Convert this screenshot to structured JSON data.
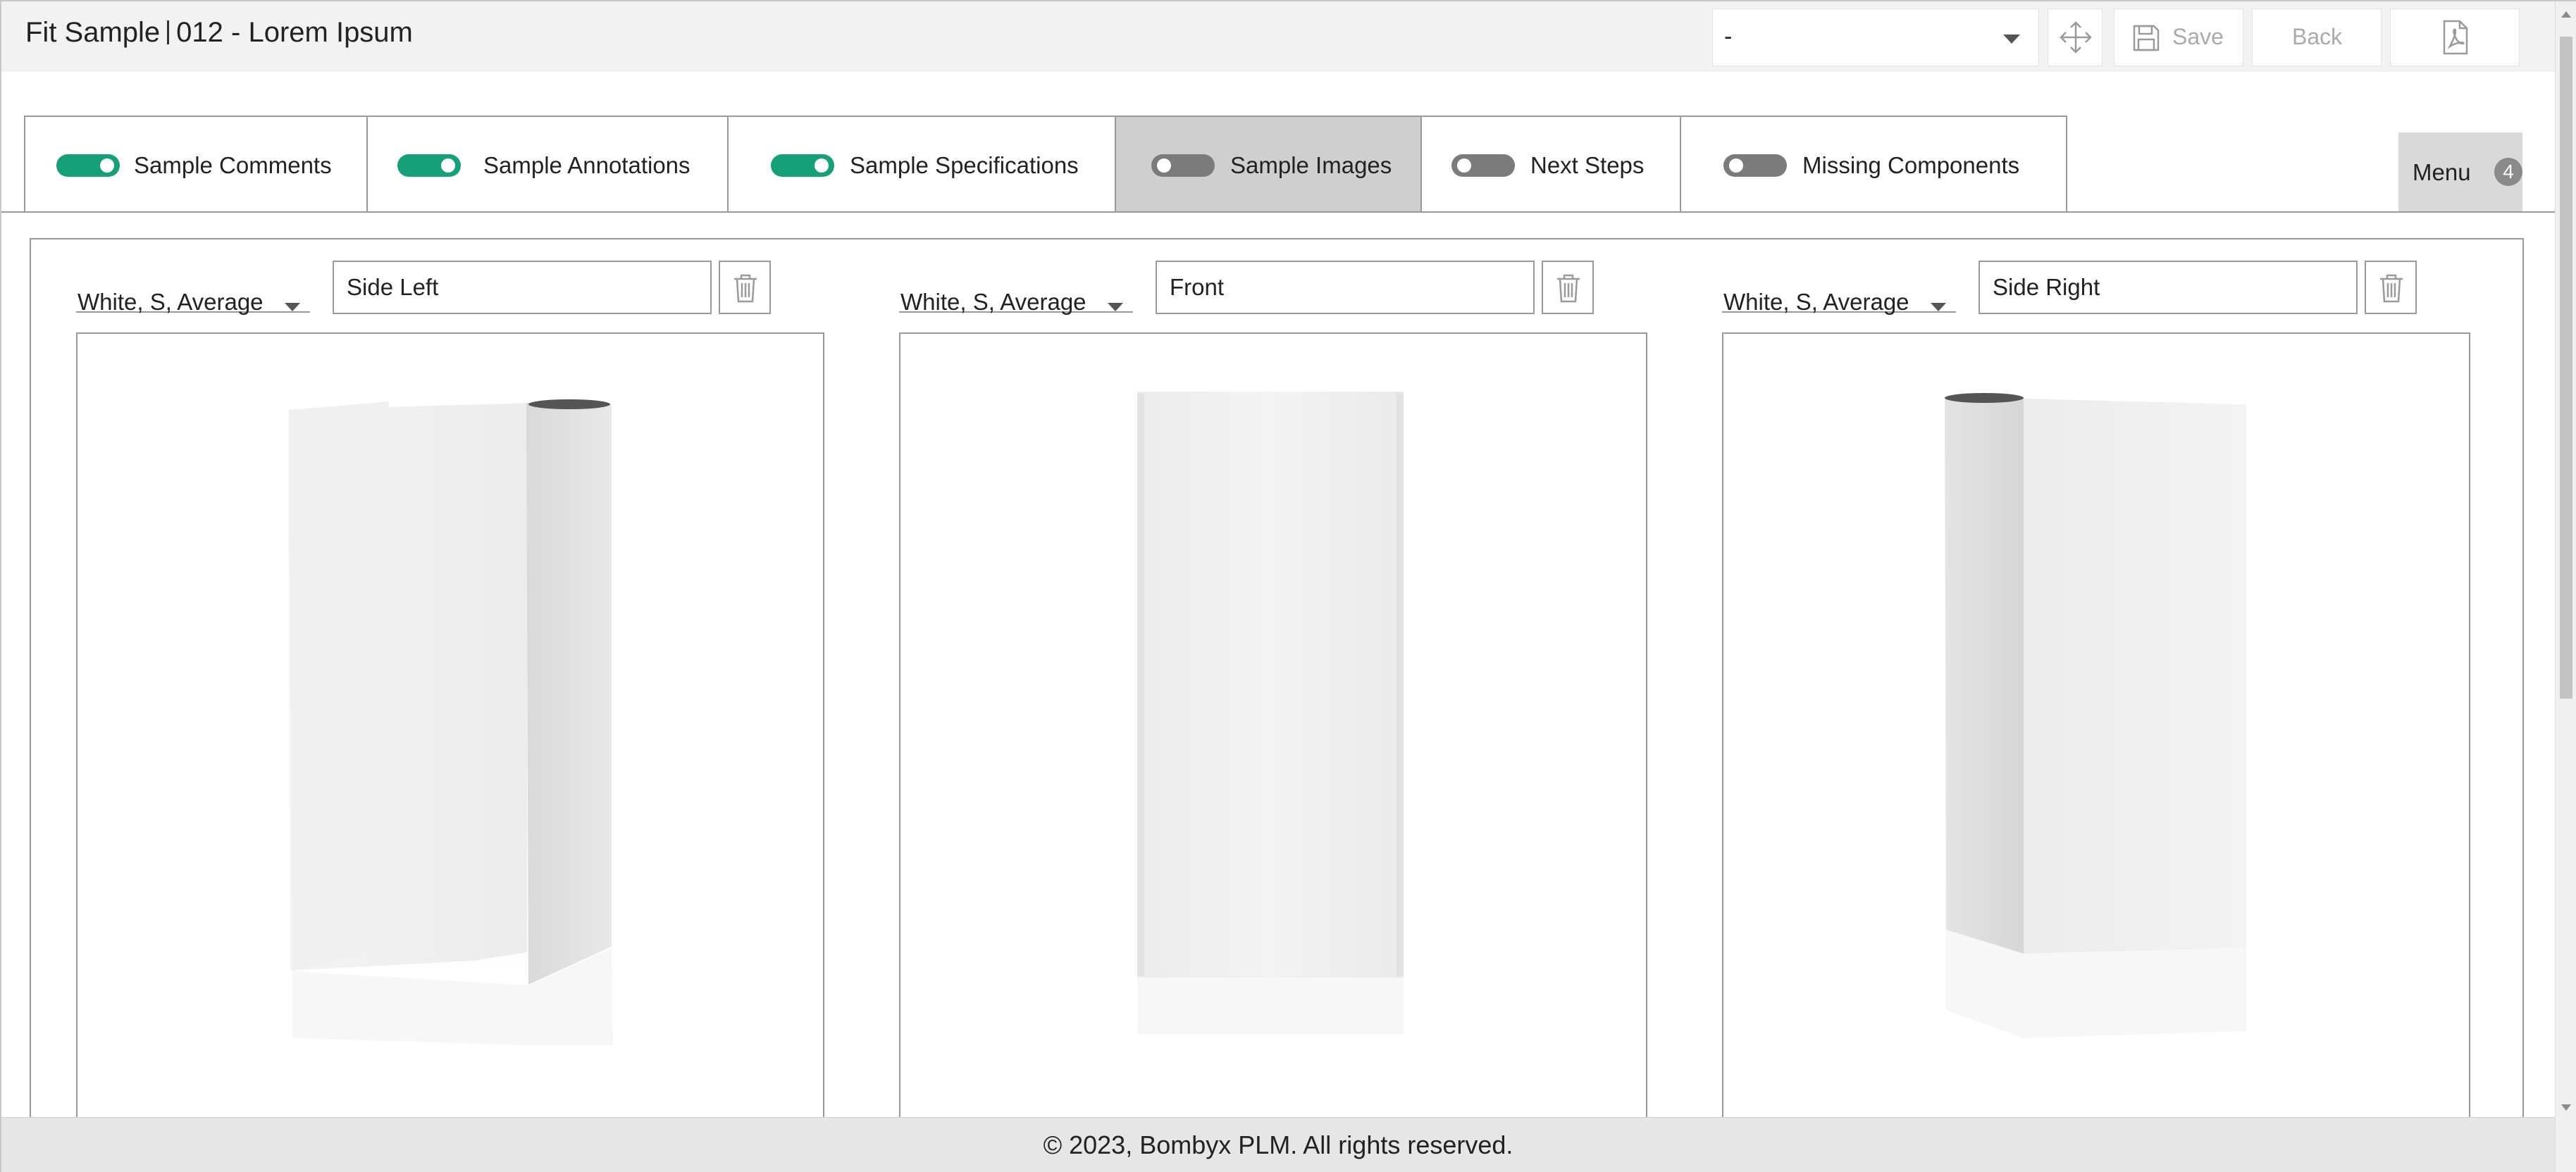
{
  "header": {
    "title_left": "Fit Sample",
    "title_right": "012 - Lorem Ipsum",
    "select_value": "-",
    "buttons": {
      "move_icon": "move-arrows-icon",
      "save_label": "Save",
      "save_icon": "floppy-disk-icon",
      "back_label": "Back",
      "pdf_icon": "pdf-file-icon"
    }
  },
  "tabs": [
    {
      "label": "Sample Comments",
      "toggle": "on",
      "active": false
    },
    {
      "label": "Sample Annotations",
      "toggle": "on",
      "active": false
    },
    {
      "label": "Sample Specifications",
      "toggle": "on",
      "active": false
    },
    {
      "label": "Sample Images",
      "toggle": "off",
      "active": true
    },
    {
      "label": "Next Steps",
      "toggle": "off",
      "active": false
    },
    {
      "label": "Missing Components",
      "toggle": "off",
      "active": false
    }
  ],
  "menu": {
    "label": "Menu",
    "badge": "4"
  },
  "images": [
    {
      "variant": "White, S, Average",
      "name": "Side Left",
      "view": "side-left"
    },
    {
      "variant": "White, S, Average",
      "name": "Front",
      "view": "front"
    },
    {
      "variant": "White, S, Average",
      "name": "Side Right",
      "view": "side-right"
    }
  ],
  "colors": {
    "toggle_on": "#15a07a",
    "toggle_off": "#7b7b7b",
    "active_tab": "#cfcfcf"
  },
  "footer": {
    "text": "© 2023, Bombyx PLM. All rights reserved."
  }
}
